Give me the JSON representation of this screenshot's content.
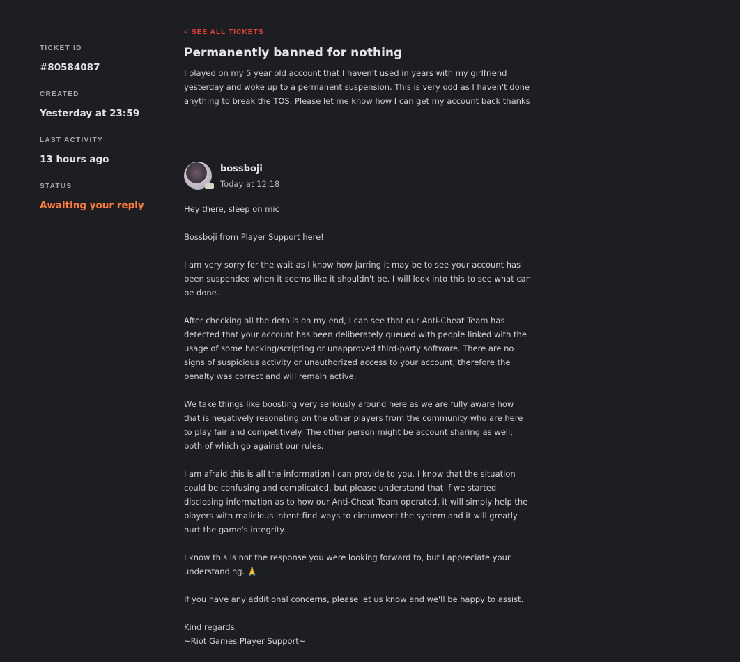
{
  "sidebar": {
    "ticket_id_label": "TICKET ID",
    "ticket_id": "#80584087",
    "created_label": "CREATED",
    "created": "Yesterday at 23:59",
    "last_activity_label": "LAST ACTIVITY",
    "last_activity": "13 hours ago",
    "status_label": "STATUS",
    "status": "Awaiting your reply"
  },
  "ticket": {
    "back_link": "< SEE ALL TICKETS",
    "title": "Permanently banned for nothing",
    "description": "I played on my 5 year old account that I haven't used in years with my girlfriend yesterday and woke up to a permanent suspension. This is very odd as I haven't done anything to break the TOS. Please let me know how I can get my account back thanks"
  },
  "reply": {
    "author": "bossboji",
    "time": "Today at 12:18",
    "paragraphs": [
      "Hey there, sleep on mic",
      "Bossboji from Player Support here!",
      "I am very sorry for the wait as I know how jarring it may be to see your account has been suspended when it seems like it shouldn't be. I will look into this to see what can be done.",
      "After checking all the details on my end, I can see that our Anti-Cheat Team has detected that your account has been deliberately queued with people linked with the usage of some hacking/scripting or unapproved third-party software. There are no signs of suspicious activity or unauthorized access to your account, therefore the penalty was correct and will remain active.",
      "We take things like boosting very seriously around here as we are fully aware how that is negatively resonating on the other players from the community who are here to play fair and competitively. The other person might be account sharing as well, both of which go against our rules.",
      "I am afraid this is all the information I can provide to you. I know that the situation could be confusing and complicated, but please understand that if we started disclosing information as to how our Anti-Cheat Team operated, it will simply help the players with malicious intent find ways to circumvent the system and it will greatly hurt the game's integrity.",
      "I know this is not the response you were looking forward to, but I appreciate your understanding. 🙏",
      "If you have any additional concerns, please let us know and we'll be happy to assist.",
      "Kind regards,",
      "~Riot Games Player Support~"
    ]
  },
  "colors": {
    "background": "#1d1e21",
    "accent_red": "#e8413b",
    "status_orange": "#ff7b38"
  }
}
